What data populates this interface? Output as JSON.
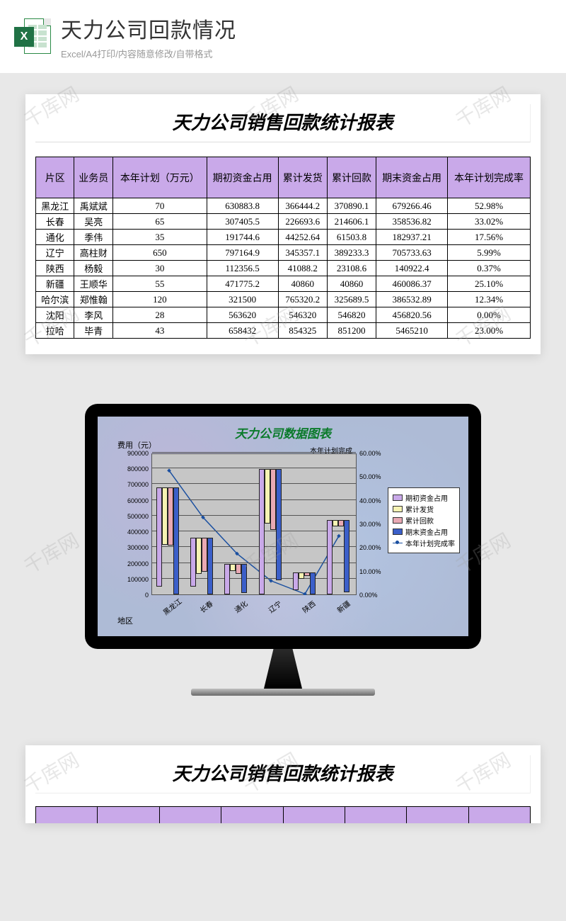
{
  "header": {
    "title": "天力公司回款情况",
    "subtitle": "Excel/A4打印/内容随意修改/自带格式",
    "icon_letter": "X"
  },
  "watermark_text": "千库网",
  "sheet": {
    "title": "天力公司销售回款统计报表",
    "columns": [
      "片区",
      "业务员",
      "本年计划（万元）",
      "期初资金占用",
      "累计发货",
      "累计回款",
      "期末资金占用",
      "本年计划完成率"
    ],
    "rows": [
      [
        "黑龙江",
        "禹斌斌",
        "70",
        "630883.8",
        "366444.2",
        "370890.1",
        "679266.46",
        "52.98%"
      ],
      [
        "长春",
        "吴亮",
        "65",
        "307405.5",
        "226693.6",
        "214606.1",
        "358536.82",
        "33.02%"
      ],
      [
        "通化",
        "季伟",
        "35",
        "191744.6",
        "44252.64",
        "61503.8",
        "182937.21",
        "17.56%"
      ],
      [
        "辽宁",
        "高柱财",
        "650",
        "797164.9",
        "345357.1",
        "389233.3",
        "705733.63",
        "5.99%"
      ],
      [
        "陕西",
        "杨毅",
        "30",
        "112356.5",
        "41088.2",
        "23108.6",
        "140922.4",
        "0.37%"
      ],
      [
        "新疆",
        "王顺华",
        "55",
        "471775.2",
        "40860",
        "40860",
        "460086.37",
        "25.10%"
      ],
      [
        "哈尔滨",
        "郑惟翰",
        "120",
        "321500",
        "765320.2",
        "325689.5",
        "386532.89",
        "12.34%"
      ],
      [
        "沈阳",
        "李风",
        "28",
        "563620",
        "546320",
        "546820",
        "456820.56",
        "0.00%"
      ],
      [
        "拉哈",
        "毕青",
        "43",
        "658432",
        "854325",
        "851200",
        "5465210",
        "23.00%"
      ]
    ]
  },
  "chart_data": {
    "type": "bar",
    "title": "天力公司数据图表",
    "y1_label": "费用（元）",
    "y2_label": "本年计划完成",
    "x_label": "地区",
    "categories": [
      "黑龙江",
      "长春",
      "通化",
      "辽宁",
      "陕西",
      "新疆"
    ],
    "y1_ticks": [
      0,
      100000,
      200000,
      300000,
      400000,
      500000,
      600000,
      700000,
      800000,
      900000
    ],
    "y2_ticks": [
      "0.00%",
      "10.00%",
      "20.00%",
      "30.00%",
      "40.00%",
      "50.00%",
      "60.00%"
    ],
    "ylim": [
      0,
      900000
    ],
    "y2lim": [
      0,
      60
    ],
    "series": [
      {
        "name": "期初资金占用",
        "color": "#c9a9e9",
        "values": [
          630884,
          307406,
          191745,
          797165,
          112357,
          471775
        ]
      },
      {
        "name": "累计发货",
        "color": "#f6f3b3",
        "values": [
          366444,
          226694,
          44253,
          345357,
          41088,
          40860
        ]
      },
      {
        "name": "累计回款",
        "color": "#e9a9b3",
        "values": [
          370890,
          214606,
          61504,
          389233,
          23109,
          40860
        ]
      },
      {
        "name": "期末资金占用",
        "color": "#3b5fc9",
        "values": [
          679266,
          358537,
          182937,
          705734,
          140922,
          460086
        ]
      }
    ],
    "line_series": {
      "name": "本年计划完成率",
      "color": "#1a4fa0",
      "values": [
        52.98,
        33.02,
        17.56,
        5.99,
        0.37,
        25.1
      ]
    }
  }
}
